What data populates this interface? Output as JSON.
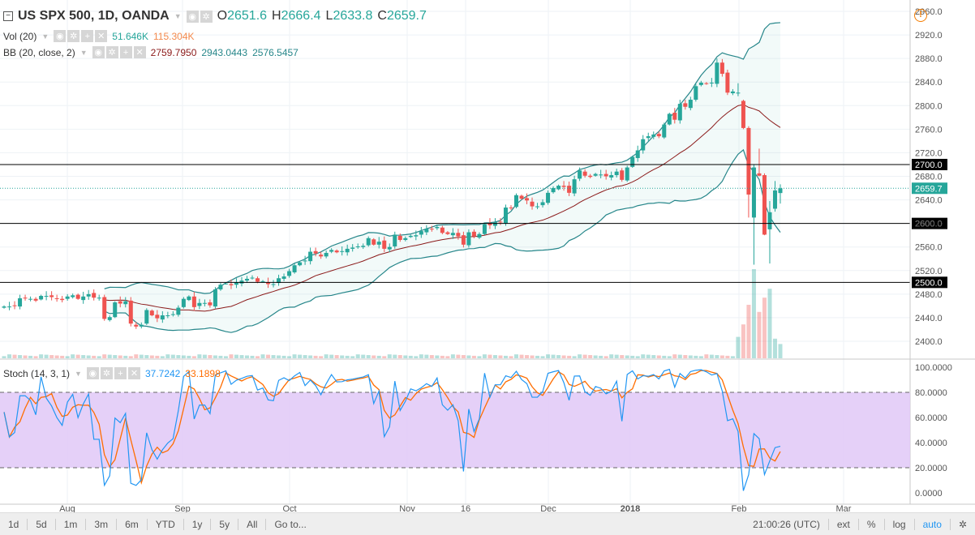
{
  "header": {
    "symbol": "US SPX 500, 1D, OANDA",
    "o_label": "O",
    "o": "2651.6",
    "h_label": "H",
    "h": "2666.4",
    "l_label": "L",
    "l": "2633.8",
    "c_label": "C",
    "c": "2659.7"
  },
  "indicators": {
    "vol": {
      "name": "Vol (20)",
      "v1": "51.646K",
      "v2": "115.304K"
    },
    "bb": {
      "name": "BB (20, close, 2)",
      "mid": "2759.7950",
      "upper": "2943.0443",
      "lower": "2576.5457"
    },
    "stoch": {
      "name": "Stoch (14, 3, 1)",
      "k": "37.7242",
      "d": "33.1898"
    }
  },
  "price_axis": [
    "2960.0",
    "2920.0",
    "2880.0",
    "2840.0",
    "2800.0",
    "2760.0",
    "2720.0",
    "2680.0",
    "2640.0",
    "2600.0",
    "2560.0",
    "2520.0",
    "2480.0",
    "2440.0",
    "2400.0"
  ],
  "stoch_axis": [
    "100.0000",
    "80.0000",
    "60.0000",
    "40.0000",
    "20.0000",
    "0.0000"
  ],
  "level_labels": [
    "2700.0",
    "2600.0",
    "2500.0"
  ],
  "current_price_label": "2659.7",
  "date_axis": [
    "Aug",
    "Sep",
    "Oct",
    "Nov",
    "16",
    "Dec",
    "2018",
    "Feb",
    "Mar"
  ],
  "toolbar": {
    "ranges": [
      "1d",
      "5d",
      "1m",
      "3m",
      "6m",
      "YTD",
      "1y",
      "5y",
      "All",
      "Go to..."
    ],
    "time": "21:00:26 (UTC)",
    "ext": "ext",
    "pct": "%",
    "log": "log",
    "auto": "auto"
  },
  "colors": {
    "up": "#26a69a",
    "down": "#ef5350",
    "bb_mid": "#8b1a1a",
    "bb_band": "#26868a",
    "stoch_k": "#2196f3",
    "stoch_d": "#ff6d00",
    "stoch_fill": "#e1c8f7"
  },
  "chart_data": {
    "type": "candlestick",
    "levels": [
      2700,
      2600,
      2500
    ],
    "current": 2659.7,
    "closes": [
      2459,
      2459,
      2460,
      2473,
      2473,
      2472,
      2469,
      2477,
      2477,
      2475,
      2472,
      2470,
      2476,
      2478,
      2472,
      2476,
      2480,
      2474,
      2474,
      2438,
      2441,
      2466,
      2464,
      2468,
      2430,
      2425,
      2428,
      2453,
      2444,
      2439,
      2444,
      2444,
      2446,
      2457,
      2472,
      2476,
      2458,
      2465,
      2465,
      2461,
      2488,
      2496,
      2498,
      2495,
      2500,
      2503,
      2506,
      2508,
      2501,
      2502,
      2497,
      2497,
      2507,
      2510,
      2519,
      2529,
      2534,
      2537,
      2552,
      2549,
      2544,
      2550,
      2555,
      2551,
      2553,
      2557,
      2559,
      2561,
      2562,
      2575,
      2564,
      2569,
      2557,
      2560,
      2581,
      2572,
      2575,
      2579,
      2580,
      2587,
      2591,
      2590,
      2594,
      2584,
      2582,
      2584,
      2578,
      2564,
      2585,
      2578,
      2582,
      2599,
      2597,
      2602,
      2602,
      2627,
      2626,
      2648,
      2642,
      2639,
      2629,
      2629,
      2636,
      2652,
      2660,
      2664,
      2662,
      2652,
      2675,
      2690,
      2681,
      2679,
      2684,
      2683,
      2680,
      2682,
      2688,
      2674,
      2695,
      2713,
      2724,
      2743,
      2748,
      2751,
      2748,
      2768,
      2786,
      2776,
      2803,
      2798,
      2810,
      2833,
      2839,
      2837,
      2839,
      2873,
      2854,
      2822,
      2824,
      2822,
      2762,
      2649,
      2695,
      2681,
      2581,
      2619,
      2656,
      2659.7
    ],
    "last_bars": [
      {
        "o": 2822,
        "h": 2838,
        "l": 2816,
        "c": 2822,
        "v": 60
      },
      {
        "o": 2808,
        "h": 2810,
        "l": 2760,
        "c": 2762,
        "v": 95
      },
      {
        "o": 2762,
        "h": 2765,
        "l": 2610,
        "c": 2649,
        "v": 150
      },
      {
        "o": 2610,
        "h": 2700,
        "l": 2530,
        "c": 2695,
        "v": 250
      },
      {
        "o": 2685,
        "h": 2727,
        "l": 2680,
        "c": 2681,
        "v": 130
      },
      {
        "o": 2682,
        "h": 2685,
        "l": 2580,
        "c": 2581,
        "v": 170
      },
      {
        "o": 2590,
        "h": 2638,
        "l": 2532,
        "c": 2619,
        "v": 195
      },
      {
        "o": 2625,
        "h": 2672,
        "l": 2620,
        "c": 2656,
        "v": 55
      },
      {
        "o": 2651.6,
        "h": 2666.4,
        "l": 2633.8,
        "c": 2659.7,
        "v": 40
      }
    ]
  }
}
